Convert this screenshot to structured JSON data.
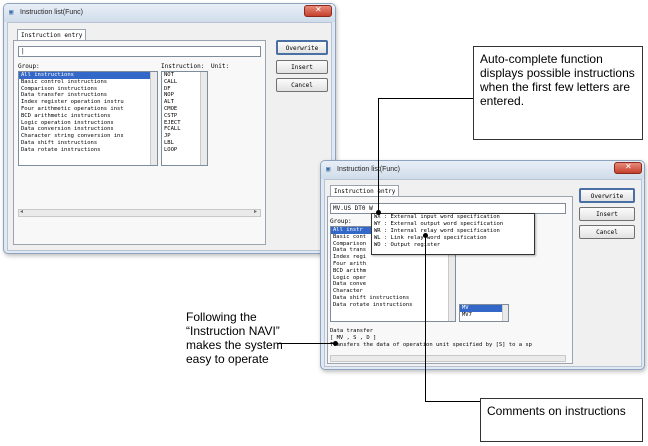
{
  "window1": {
    "title": "Instruction list(Func)",
    "tab_label": "Instruction entry",
    "input_value": "|",
    "group_label": "Group:",
    "instruction_label": "Instruction:",
    "unit_label": "Unit:",
    "buttons": {
      "overwrite": "Overwrite",
      "insert": "Insert",
      "cancel": "Cancel"
    },
    "groups": [
      "All instructions",
      "Basic control instructions",
      "Comparison instructions",
      "Data transfer instructions",
      "Index register operation instru",
      "Four arithmetic operations inst",
      "BCD arithmetic instructions",
      "Logic operation instructions",
      "Data conversion instructions",
      "Character string conversion ins",
      "Data shift instructions",
      "Data rotate instructions"
    ],
    "instructions": [
      "NOT",
      "CALL",
      "DF",
      "NOP",
      "ALT",
      "CMOE",
      "CSTP",
      "EJECT",
      "FCALL",
      "JP",
      "LBL",
      "LOOP"
    ]
  },
  "window2": {
    "title": "Instruction list(Func)",
    "tab_label": "Instruction entry",
    "input_value": "MV.US DT0 W",
    "group_label": "Group:",
    "groups": [
      "All instr",
      "Basic cont",
      "Comparison",
      "Data trans",
      "Index regi",
      "Four arith",
      "BCD arithm",
      "Logic oper",
      "Data conve",
      "Character",
      "Data shift instructions",
      "Data rotate instructions"
    ],
    "popup_items": [
      {
        "code": "WX",
        "desc": ": External input word specification"
      },
      {
        "code": "WY",
        "desc": ": External output word specification"
      },
      {
        "code": "WR",
        "desc": ": Internal relay word specification"
      },
      {
        "code": "WL",
        "desc": ": Link relay word specification"
      },
      {
        "code": "WO",
        "desc": ": Output register"
      }
    ],
    "mini_list": [
      "MV",
      "MV7"
    ],
    "comment_head": "Data transfer",
    "comment_syntax": "[ MV , S , D ]",
    "comment_text": "Transfers the data of operation unit specified by [S] to a sp",
    "buttons": {
      "overwrite": "Overwrite",
      "insert": "Insert",
      "cancel": "Cancel"
    }
  },
  "callouts": {
    "autocomplete": "Auto-complete function displays possible instructions when the first few letters are entered.",
    "navi": "Following the “Instruction NAVI” makes the system easy to operate",
    "comments": "Comments on instructions"
  }
}
